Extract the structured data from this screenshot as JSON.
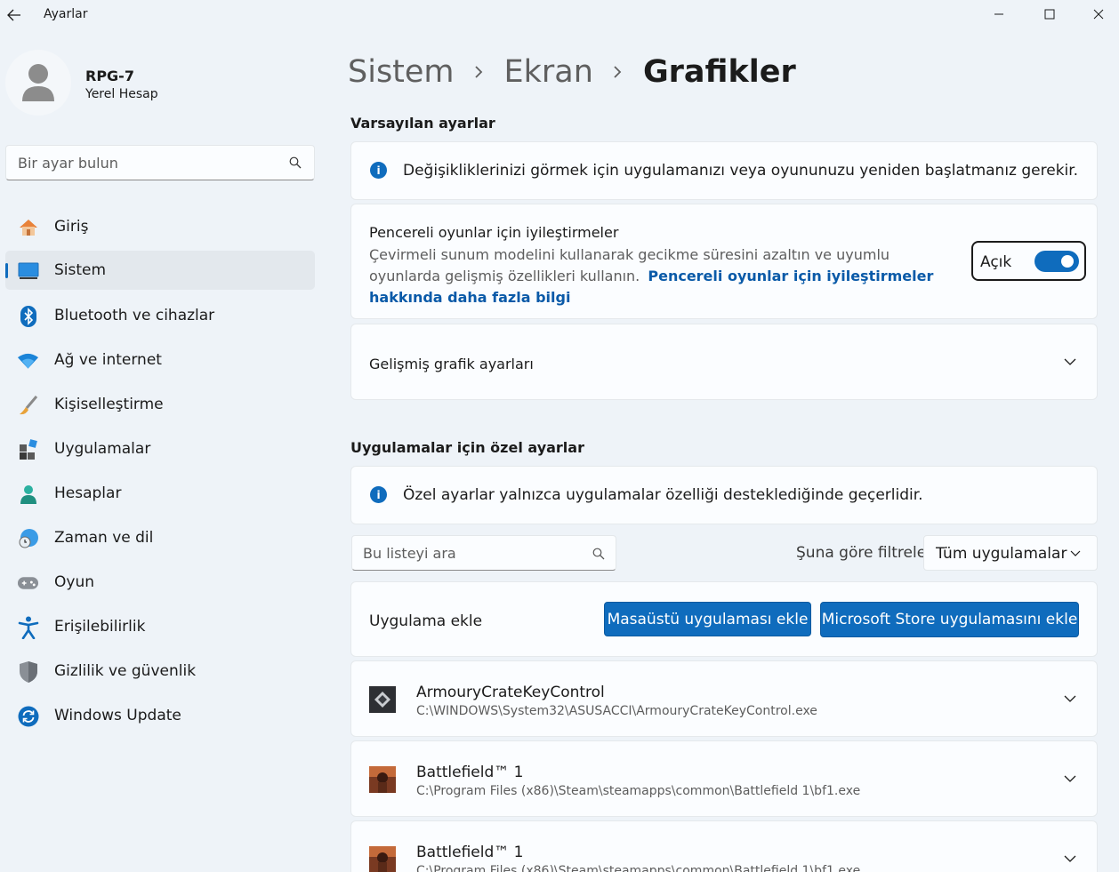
{
  "window": {
    "title": "Ayarlar"
  },
  "profile": {
    "name": "RPG-7",
    "account_type": "Yerel Hesap"
  },
  "search": {
    "placeholder": "Bir ayar bulun"
  },
  "nav": [
    {
      "label": "Giriş",
      "icon": "home-icon"
    },
    {
      "label": "Sistem",
      "icon": "system-icon",
      "active": true
    },
    {
      "label": "Bluetooth ve cihazlar",
      "icon": "bluetooth-icon"
    },
    {
      "label": "Ağ ve internet",
      "icon": "wifi-icon"
    },
    {
      "label": "Kişiselleştirme",
      "icon": "brush-icon"
    },
    {
      "label": "Uygulamalar",
      "icon": "apps-icon"
    },
    {
      "label": "Hesaplar",
      "icon": "accounts-icon"
    },
    {
      "label": "Zaman ve dil",
      "icon": "time-language-icon"
    },
    {
      "label": "Oyun",
      "icon": "gaming-icon"
    },
    {
      "label": "Erişilebilirlik",
      "icon": "accessibility-icon"
    },
    {
      "label": "Gizlilik ve güvenlik",
      "icon": "shield-icon"
    },
    {
      "label": "Windows Update",
      "icon": "windows-update-icon"
    }
  ],
  "breadcrumb": {
    "items": [
      "Sistem",
      "Ekran"
    ],
    "current": "Grafikler"
  },
  "default_settings": {
    "title": "Varsayılan ayarlar",
    "info": "Değişikliklerinizi görmek için uygulamanızı veya oyununuzu yeniden başlatmanız gerekir.",
    "windowed": {
      "title": "Pencereli oyunlar için iyileştirmeler",
      "description": "Çevirmeli sunum modelini kullanarak gecikme süresini azaltın ve uyumlu oyunlarda gelişmiş özellikleri kullanın.",
      "link": "Pencereli oyunlar için iyileştirmeler hakkında daha fazla bilgi",
      "toggle_label": "Açık",
      "toggle_on": true
    },
    "advanced": {
      "label": "Gelişmiş grafik ayarları"
    }
  },
  "custom_settings": {
    "title": "Uygulamalar için özel ayarlar",
    "info": "Özel ayarlar yalnızca uygulamalar özelliği desteklediğinde geçerlidir.",
    "list_search_placeholder": "Bu listeyi ara",
    "filter_label": "Şuna göre filtrele:",
    "filter_value": "Tüm uygulamalar",
    "add_app_label": "Uygulama ekle",
    "add_desktop_button": "Masaüstü uygulaması ekle",
    "add_store_button": "Microsoft Store uygulamasını ekle",
    "apps": [
      {
        "name": "ArmouryCrateKeyControl",
        "path": "C:\\WINDOWS\\System32\\ASUSACCI\\ArmouryCrateKeyControl.exe",
        "icon": "armoury-crate-icon"
      },
      {
        "name": "Battlefield™ 1",
        "path": "C:\\Program Files (x86)\\Steam\\steamapps\\common\\Battlefield 1\\bf1.exe",
        "icon": "battlefield-icon"
      },
      {
        "name": "Battlefield™ 1",
        "path": "C:\\Program Files (x86)\\Steam\\steamapps\\common\\Battlefield 1\\bf1.exe",
        "icon": "battlefield-icon"
      }
    ]
  },
  "colors": {
    "accent": "#0f6cbd",
    "background": "#eef3f8",
    "card": "#fbfdff"
  }
}
